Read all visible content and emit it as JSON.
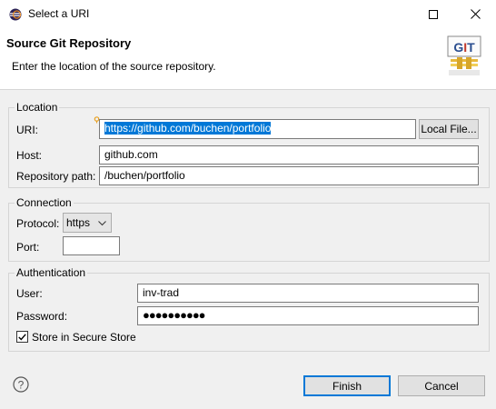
{
  "window": {
    "title": "Select a URI"
  },
  "banner": {
    "title": "Source Git Repository",
    "description": "Enter the location of the source repository.",
    "logo_text": "GIT"
  },
  "location": {
    "group_label": "Location",
    "uri_label": "URI:",
    "uri_value": "https://github.com/buchen/portfolio",
    "local_file_button": "Local File...",
    "host_label": "Host:",
    "host_value": "github.com",
    "path_label": "Repository path:",
    "path_value": "/buchen/portfolio"
  },
  "connection": {
    "group_label": "Connection",
    "protocol_label": "Protocol:",
    "protocol_value": "https",
    "port_label": "Port:",
    "port_value": ""
  },
  "authentication": {
    "group_label": "Authentication",
    "user_label": "User:",
    "user_value": "inv-trad",
    "password_label": "Password:",
    "password_mask": "●●●●●●●●●●",
    "secure_store_label": "Store in Secure Store",
    "secure_store_checked": true
  },
  "footer": {
    "finish_button": "Finish",
    "cancel_button": "Cancel"
  },
  "colors": {
    "selection": "#0078d7",
    "default_button_border": "#0078d7"
  }
}
